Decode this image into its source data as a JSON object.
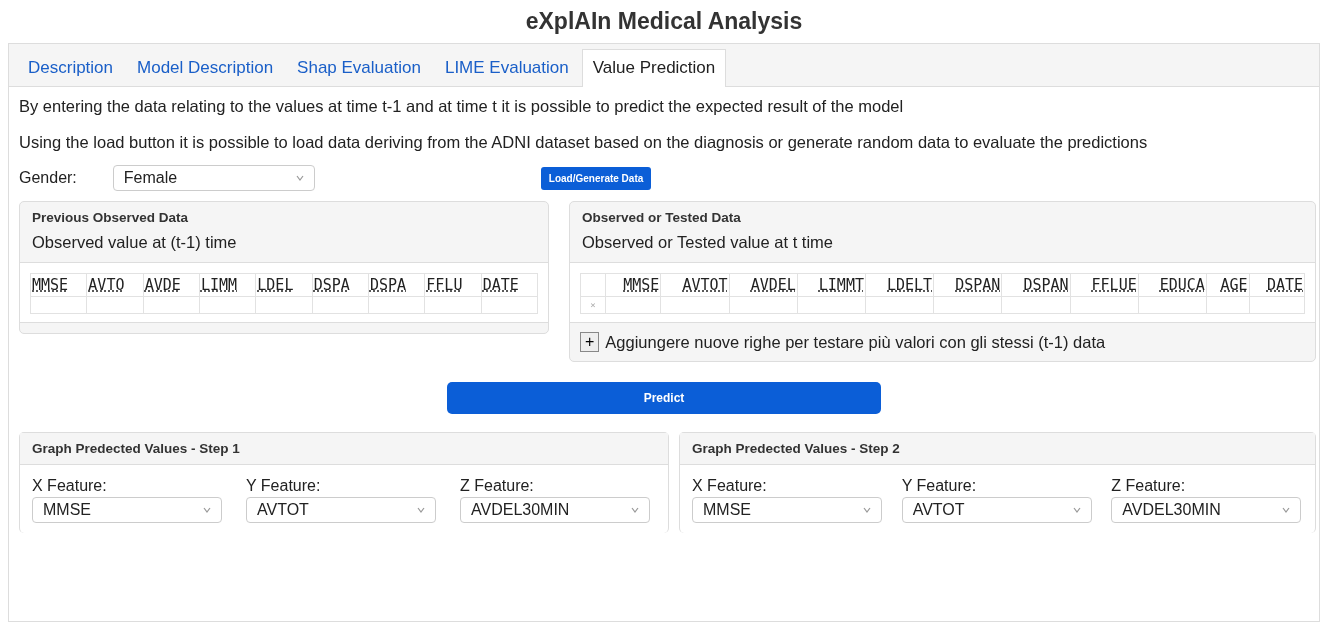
{
  "title": "eXplAIn Medical Analysis",
  "tabs": [
    {
      "label": "Description",
      "selected": false
    },
    {
      "label": "Model Description",
      "selected": false
    },
    {
      "label": "Shap Evaluation",
      "selected": false
    },
    {
      "label": "LIME Evaluation",
      "selected": false
    },
    {
      "label": "Value Prediction",
      "selected": true
    }
  ],
  "intro": [
    "By entering the data relating to the values at time t-1 and at time t it is possible to predict the expected result of the model",
    "Using the load button it is possible to load data deriving from the ADNI dataset based on the diagnosis or generate random data to evaluate the predictions"
  ],
  "gender": {
    "label": "Gender:",
    "value": "Female"
  },
  "load_button": "Load/Generate Data",
  "previous_panel": {
    "header": "Previous Observed Data",
    "subtitle": "Observed value at (t-1) time",
    "columns": [
      "MMSE",
      "AVTO",
      "AVDE",
      "LIMM",
      "LDEL",
      "DSPA",
      "DSPA",
      "FFLU",
      "DATE"
    ]
  },
  "current_panel": {
    "header": "Observed or Tested Data",
    "subtitle": "Observed or Tested value at t time",
    "columns": [
      "MMSE",
      "AVTOT",
      "AVDEL",
      "LIMMT",
      "LDELT",
      "DSPAN",
      "DSPAN",
      "FFLUE",
      "EDUCA",
      "AGE",
      "DATE"
    ],
    "row_delete": "×",
    "add_button": "+",
    "add_label": "Aggiungere nuove righe per testare più valori con gli stessi (t-1) data"
  },
  "predict_button": "Predict",
  "graphs": [
    {
      "header": "Graph Predected Values - Step 1",
      "features": [
        {
          "label": "X Feature:",
          "value": "MMSE"
        },
        {
          "label": "Y Feature:",
          "value": "AVTOT"
        },
        {
          "label": "Z Feature:",
          "value": "AVDEL30MIN"
        }
      ]
    },
    {
      "header": "Graph Predected Values - Step 2",
      "features": [
        {
          "label": "X Feature:",
          "value": "MMSE"
        },
        {
          "label": "Y Feature:",
          "value": "AVTOT"
        },
        {
          "label": "Z Feature:",
          "value": "AVDEL30MIN"
        }
      ]
    }
  ]
}
